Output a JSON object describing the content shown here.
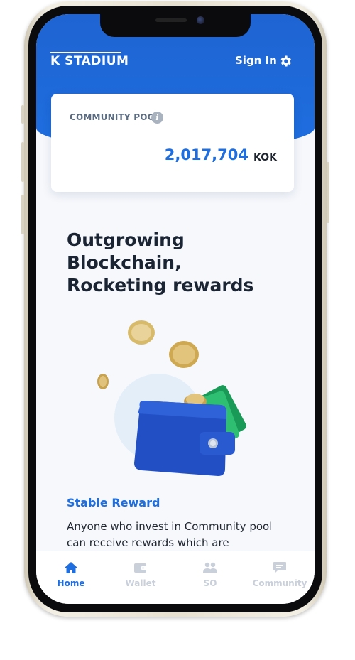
{
  "header": {
    "logo_text": "K STADIUM",
    "sign_in_label": "Sign In",
    "settings_icon": "gear-icon"
  },
  "pool_card": {
    "label": "COMMUNITY POOL",
    "info_icon": "info-icon",
    "amount": "2,017,704",
    "unit": "KOK"
  },
  "hero": {
    "line1": "Outgrowing Blockchain,",
    "line2": "Rocketing rewards",
    "illustration": "wallet-with-coins"
  },
  "section": {
    "title": "Stable Reward",
    "body": "Anyone who invest in Community pool can receive rewards which are"
  },
  "tabs": [
    {
      "label": "Home",
      "icon": "home-icon",
      "active": true
    },
    {
      "label": "Wallet",
      "icon": "wallet-icon",
      "active": false
    },
    {
      "label": "SO",
      "icon": "people-icon",
      "active": false
    },
    {
      "label": "Community",
      "icon": "chat-icon",
      "active": false
    }
  ],
  "colors": {
    "primary": "#1e6ee0",
    "header_gradient_top": "#1f64d2",
    "text_dark": "#1a2433",
    "tab_inactive": "#c9d0da"
  }
}
